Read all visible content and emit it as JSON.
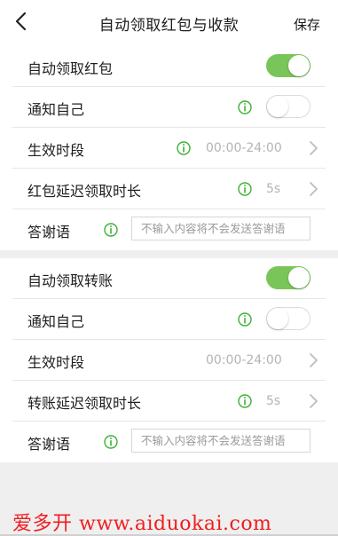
{
  "header": {
    "title": "自动领取红包与收款",
    "save_label": "保存"
  },
  "red_packet_section": {
    "auto_receive_label": "自动领取红包",
    "auto_receive_on": true,
    "notify_label": "通知自己",
    "notify_on": false,
    "active_period_label": "生效时段",
    "active_period_value": "00:00-24:00",
    "delay_label": "红包延迟领取时长",
    "delay_value": "5s",
    "thanks_label": "答谢语",
    "thanks_placeholder": "不输入内容将不会发送答谢语"
  },
  "transfer_section": {
    "auto_receive_label": "自动领取转账",
    "auto_receive_on": true,
    "notify_label": "通知自己",
    "notify_on": false,
    "active_period_label": "生效时段",
    "active_period_value": "00:00-24:00",
    "delay_label": "转账延迟领取时长",
    "delay_value": "5s",
    "thanks_label": "答谢语",
    "thanks_placeholder": "不输入内容将不会发送答谢语"
  },
  "watermark": {
    "text": "爱多开 www.aiduokai.com"
  },
  "colors": {
    "accent_green": "#7ac55a",
    "info_icon_green": "#3cb034",
    "watermark_red": "#f01e1e"
  }
}
